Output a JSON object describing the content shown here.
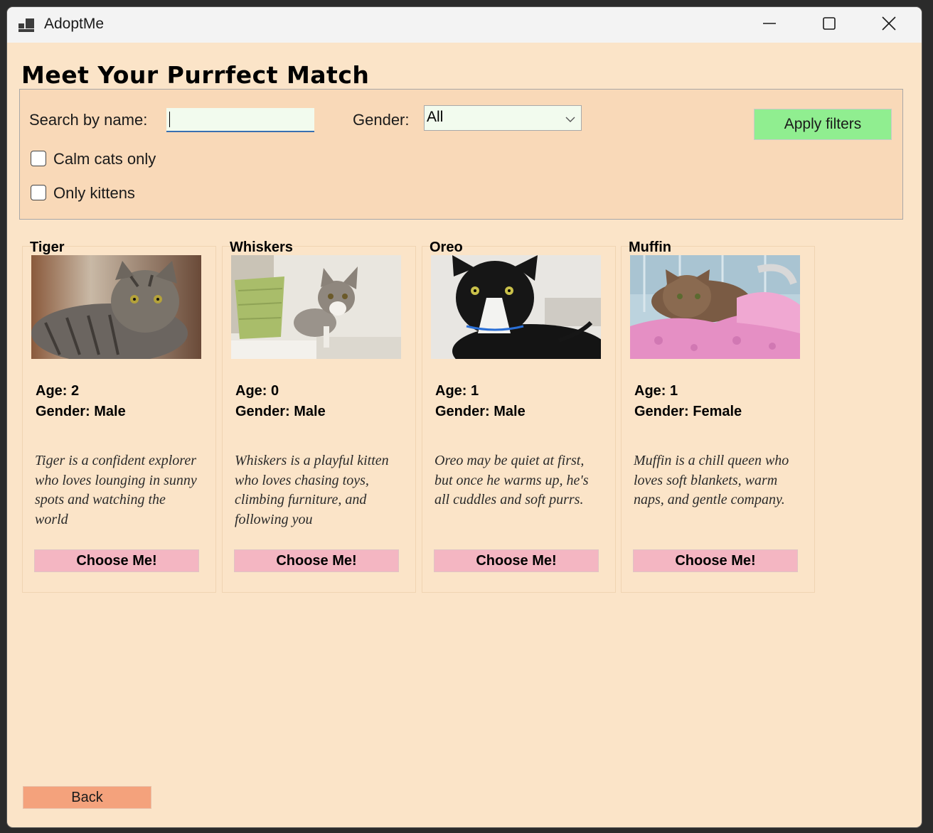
{
  "window": {
    "title": "AdoptMe"
  },
  "heading": "Meet Your Purrfect Match",
  "filters": {
    "search_label": "Search by name:",
    "search_value": "",
    "gender_label": "Gender:",
    "gender_value": "All",
    "apply_label": "Apply filters",
    "calm_label": "Calm cats only",
    "calm_checked": false,
    "kittens_label": "Only kittens",
    "kittens_checked": false
  },
  "cats": [
    {
      "name": "Tiger",
      "age": "Age: 2",
      "gender": "Gender: Male",
      "description": "Tiger is a confident explorer who loves lounging in sunny spots and watching the world",
      "button": "Choose Me!"
    },
    {
      "name": "Whiskers",
      "age": "Age: 0",
      "gender": "Gender: Male",
      "description": "Whiskers is a playful kitten who loves chasing toys, climbing furniture, and following you",
      "button": "Choose Me!"
    },
    {
      "name": "Oreo",
      "age": "Age: 1",
      "gender": "Gender: Male",
      "description": "Oreo may be quiet at first, but once he warms up, he's all cuddles and soft purrs.",
      "button": "Choose Me!"
    },
    {
      "name": "Muffin",
      "age": "Age: 1",
      "gender": "Gender: Female",
      "description": "Muffin is a chill queen who loves soft blankets, warm naps, and gentle company.",
      "button": "Choose Me!"
    }
  ],
  "back_label": "Back",
  "colors": {
    "background": "#fbe4c8",
    "filter_panel": "#f9d9b8",
    "apply_button": "#90ee90",
    "choose_button": "#f4b6c2",
    "back_button": "#f4a27c"
  },
  "icons": {
    "app": "app-window-icon",
    "minimize": "minimize-icon",
    "maximize": "maximize-icon",
    "close": "close-icon",
    "dropdown": "chevron-down-icon"
  }
}
